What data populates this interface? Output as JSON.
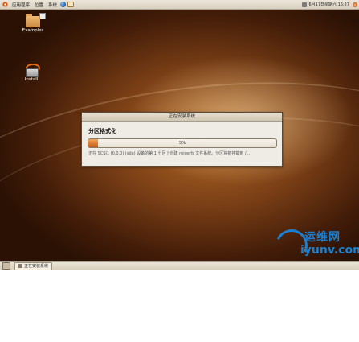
{
  "top_panel": {
    "menus": [
      "应用程序",
      "位置",
      "系统"
    ],
    "clock": "6月17日星期六 16:27"
  },
  "desktop": {
    "icons": [
      {
        "label": "Examples",
        "icon": "folder-icon"
      },
      {
        "label": "Install",
        "icon": "install-icon"
      }
    ]
  },
  "dialog": {
    "title": "正在安装系统",
    "heading": "分区格式化",
    "progress_percent": 5,
    "progress_label": "5%",
    "status": "正在 SCSI1 (0,0,0) (sda) 设备的第 1 分区上创建 reiserfs 文件系统。分区将被挂载到 /..."
  },
  "bottom_panel": {
    "task_label": "正在安装系统"
  },
  "watermark": {
    "text_cn": "运维网",
    "text_en": "iyunv.com"
  },
  "colors": {
    "accent": "#d45b0a",
    "watermark": "#1a7fd0"
  }
}
